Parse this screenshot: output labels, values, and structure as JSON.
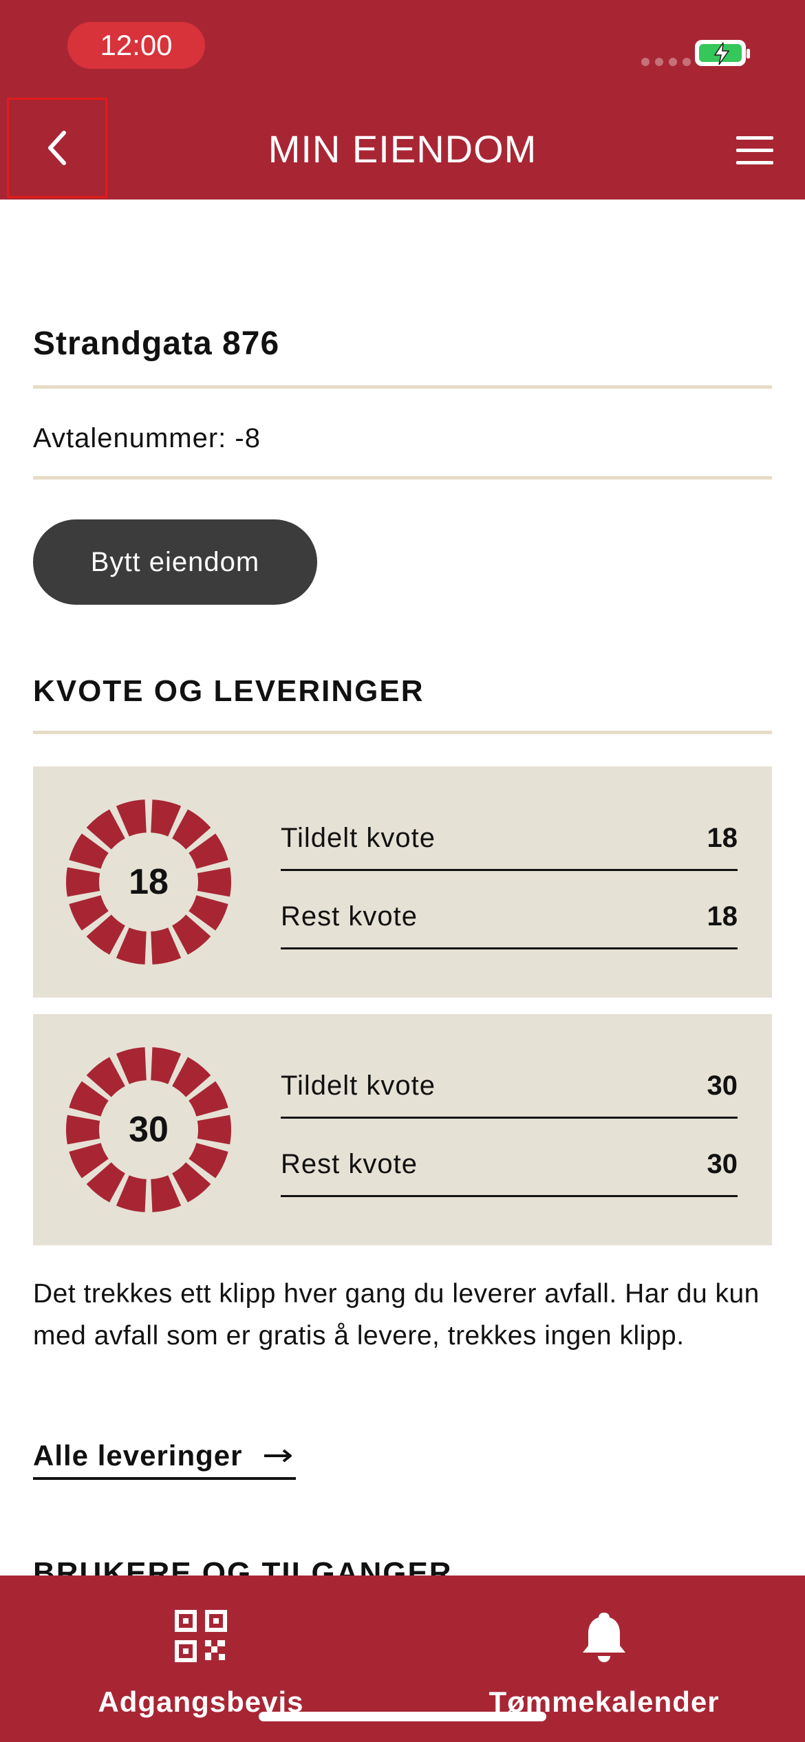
{
  "status_bar": {
    "time": "12:00"
  },
  "header": {
    "title": "MIN EIENDOM",
    "back_icon": "chevron-left-icon",
    "menu_icon": "hamburger-menu-icon",
    "color": "#a82634"
  },
  "property": {
    "address": "Strandgata 876",
    "contract_label": "Avtalenummer: -8",
    "switch_button_label": "Bytt eiendom"
  },
  "quota_section": {
    "title": "KVOTE OG LEVERINGER",
    "cards": [
      {
        "donut_value": "18",
        "rows": [
          {
            "label": "Tildelt kvote",
            "value": "18"
          },
          {
            "label": "Rest kvote",
            "value": "18"
          }
        ]
      },
      {
        "donut_value": "30",
        "rows": [
          {
            "label": "Tildelt kvote",
            "value": "30"
          },
          {
            "label": "Rest kvote",
            "value": "30"
          }
        ]
      }
    ],
    "info_text": "Det trekkes ett klipp hver gang du leverer avfall. Har du kun med avfall som er gratis å levere, trekkes ingen klipp.",
    "all_deliveries_label": "Alle leveringer"
  },
  "next_section": {
    "title": "BRUKERE OG TILGANGER"
  },
  "bottom_nav": {
    "items": [
      {
        "label": "Adgangsbevis",
        "icon": "qr-code-icon"
      },
      {
        "label": "Tømmekalender",
        "icon": "bell-icon"
      }
    ]
  },
  "colors": {
    "accent": "#a82634",
    "card_bg": "#e6e1d5",
    "divider": "#e6dcc6",
    "button_dark": "#3c3c3c"
  }
}
